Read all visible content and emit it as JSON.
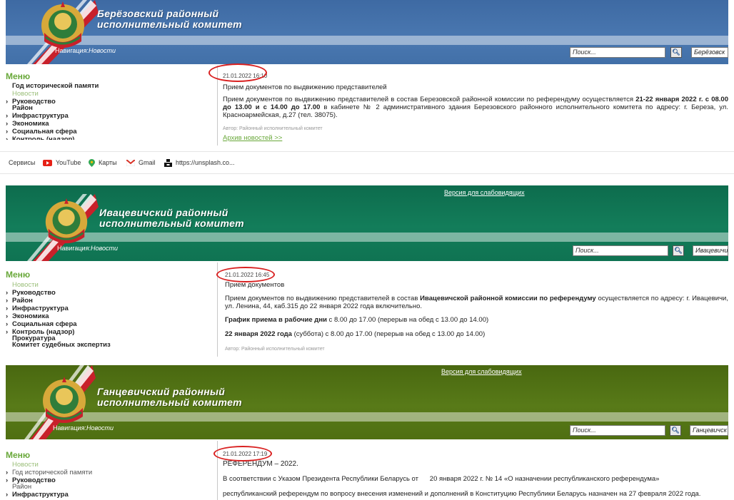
{
  "colors": {
    "blue": "#4570a8",
    "green": "#117a58",
    "olive": "#4e6d12",
    "menu_green": "#69a83a",
    "ellipse_red": "#d92020"
  },
  "site1": {
    "title_line1": "Берёзовский районный",
    "title_line2": "исполнительный комитет",
    "nav_label": "Навигация:",
    "nav_current": "Новости",
    "search_placeholder": "Поиск...",
    "search_btn_icon": "search-icon",
    "site_field": "Берёзовск",
    "menu_title": "Меню",
    "menu_items": [
      "Год исторической памяти",
      "Новости",
      "Руководство",
      "Район",
      "Инфраструктура",
      "Экономика",
      "Социальная сфера",
      "Контроль (надзор)"
    ],
    "date": "21.01.2022 16:10",
    "heading": "Прием документов по выдвижению представителей",
    "para_a": "Прием документов по выдвижению представителей в состав Березовской районной комиссии по референдуму осуществляется ",
    "para_b": "21-22 января 2022 г. с 08.00 до 13.00 и с 14.00 до 17.00",
    "para_c": " в кабинете № 2 административного здания Березовского районного исполнительного комитета по адресу: г. Береза, ул. Красноармейская, д.27 (тел. 38075).",
    "author": "Автор: Районный исполнительный комитет",
    "archive": "Архив новостей >>"
  },
  "bookmarks": [
    {
      "label": "Сервисы",
      "icon": "apps-icon"
    },
    {
      "label": "YouTube",
      "icon": "youtube-icon"
    },
    {
      "label": "Карты",
      "icon": "maps-pin-icon"
    },
    {
      "label": "Gmail",
      "icon": "gmail-icon"
    },
    {
      "label": "https://unsplash.co...",
      "icon": "unsplash-icon"
    }
  ],
  "site2": {
    "low_vision": "Версия для слабовидящих",
    "title_line1": "Ивацевичский районный",
    "title_line2": "исполнительный комитет",
    "nav_label": "Навигация:",
    "nav_current": "Новости",
    "search_placeholder": "Поиск...",
    "site_field": "Ивацевичи",
    "menu_title": "Меню",
    "menu_items": [
      "Новости",
      "Руководство",
      "Район",
      "Инфраструктура",
      "Экономика",
      "Социальная сфера",
      "Контроль (надзор)",
      "Прокуратура",
      "Комитет судебных экспертиз"
    ],
    "date": "21.01.2022 16:45",
    "heading": "Прием документов",
    "para_a": "Прием документов по выдвижению представителей в состав ",
    "para_b": "Ивацевичской районной комиссии по референдуму",
    "para_c": " осуществляется по адресу: г. Ивацевичи, ул. Ленина, 44, каб.315 до 22 января 2022 года включительно.",
    "sched_b": "График приема в рабочие дни",
    "sched_rest": " с 8.00 до 17.00 (перерыв на обед с 13.00 до 14.00)",
    "sat_b": "22 января 2022 года",
    "sat_rest": " (суббота) с 8.00 до 17.00 (перерыв на обед с 13.00 до 14.00)",
    "author": "Автор: Районный исполнительный комитет"
  },
  "site3": {
    "low_vision": "Версия для слабовидящих",
    "title_line1": "Ганцевичский районный",
    "title_line2": "исполнительный комитет",
    "nav_label": "Навигация:",
    "nav_current": "Новости",
    "search_placeholder": "Поиск...",
    "site_field": "Ганцевичск",
    "menu_title": "Меню",
    "menu_items": [
      "Новости",
      "Год исторической памяти",
      "Руководство",
      "Район",
      "Инфраструктура"
    ],
    "date": "21.01.2022 17:19",
    "heading": "РЕФЕРЕНДУМ – 2022.",
    "p1": "В соответствии с Указом Президента Республики Беларусь от      20 января 2022 г. № 14 «О назначении республиканского референдума»",
    "p2": "республиканский референдум по вопросу внесения изменений и дополнений в Конституцию Республики Беларусь назначен на 27 февраля 2022 года."
  }
}
